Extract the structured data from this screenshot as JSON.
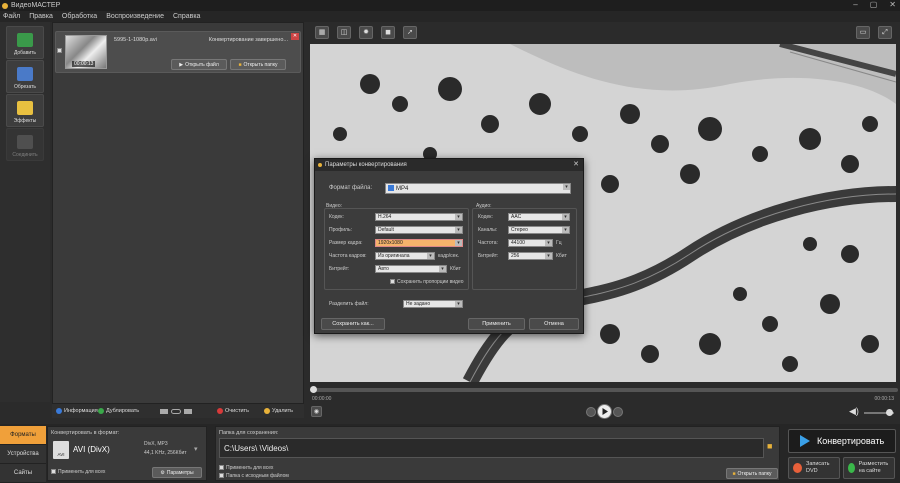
{
  "app": {
    "title": "ВидеоМАСТЕР"
  },
  "menu": [
    "Файл",
    "Правка",
    "Обработка",
    "Воспроизведение",
    "Справка"
  ],
  "tools": {
    "add": "Добавить",
    "trim": "Обрезать",
    "effects": "Эффекты",
    "join": "Соединить"
  },
  "file": {
    "name": "5995-1-1080p.avi",
    "duration": "00:00:13",
    "status": "Конвертирование завершено...",
    "open_file": "Открыть файл",
    "open_folder": "Открыть папку"
  },
  "list_bar": {
    "info": "Информация",
    "duplicate": "Дублировать",
    "clear": "Очистить",
    "delete": "Удалить"
  },
  "timeline": {
    "current": "00:00:00",
    "total": "00:00:13"
  },
  "dialog": {
    "title": "Параметры конвертирования",
    "format_label": "Формат файла:",
    "format_value": "MP4",
    "video_group": "Видео:",
    "audio_group": "Аудио:",
    "codec_label": "Кодек:",
    "codec_value": "H.264",
    "profile_label": "Профиль:",
    "profile_value": "Default",
    "size_label": "Размер кадра:",
    "size_value": "1920x1080",
    "fps_label": "Частота кадров:",
    "fps_value": "Из оригинала",
    "fps_unit": "кадр/сек.",
    "vbitrate_label": "Битрейт:",
    "vbitrate_value": "Авто",
    "vbitrate_unit": "Кбит",
    "keep_aspect": "Сохранить пропорции видео",
    "acodec_label": "Кодек:",
    "acodec_value": "AAC",
    "channels_label": "Каналы:",
    "channels_value": "Стерео",
    "freq_label": "Частота:",
    "freq_value": "44100",
    "freq_unit": "Гц",
    "abitrate_label": "Битрейт:",
    "abitrate_value": "256",
    "abitrate_unit": "Кбит",
    "split_label": "Разделить файл:",
    "split_value": "Не задано",
    "save_as": "Сохранить как...",
    "apply": "Применить",
    "cancel": "Отмена"
  },
  "bottom": {
    "tabs": [
      "Форматы",
      "Устройства",
      "Сайты"
    ],
    "convert_to_label": "Конвертировать в формат:",
    "format_name": "AVI (DivX)",
    "format_details1": "DivX, MP3",
    "format_details2": "44,1 KHz, 256Кбит",
    "format_badge": "AVI",
    "apply_all": "Применить для всех",
    "params": "Параметры",
    "save_folder_label": "Папка для сохранения:",
    "save_path": "C:\\Users\\        \\Videos\\",
    "apply_all2": "Применить для всех",
    "source_folder": "Папка с исходным файлом",
    "open_folder": "Открыть папку",
    "convert": "Конвертировать",
    "burn_dvd": "Записать DVD",
    "publish": "Разместить на сайте"
  },
  "colors": {
    "accent": "#f0a03a",
    "highlight": "#f5b36b"
  }
}
